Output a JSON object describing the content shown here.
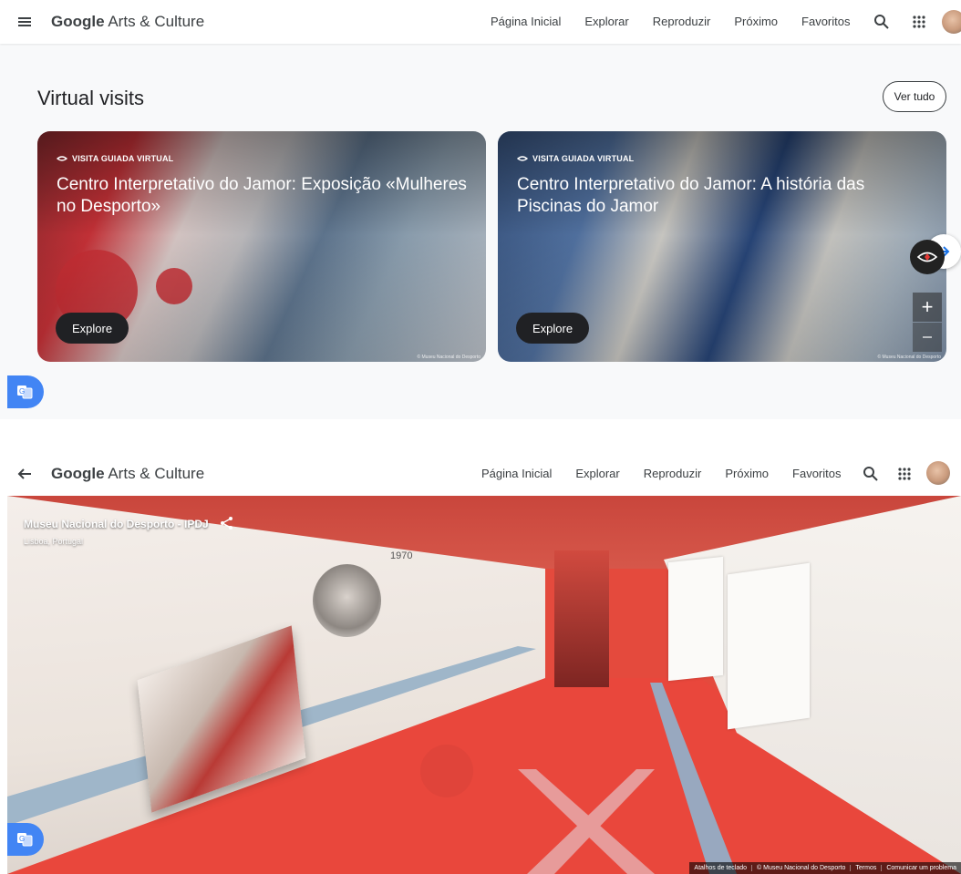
{
  "header": {
    "logo_brand": "Google",
    "logo_rest": " Arts & Culture",
    "nav": [
      "Página Inicial",
      "Explorar",
      "Reproduzir",
      "Próximo",
      "Favoritos"
    ],
    "menu_icon": "menu-icon",
    "search_icon": "search-icon",
    "apps_icon": "apps-grid-icon"
  },
  "section": {
    "title": "Virtual visits",
    "see_all": "Ver tudo"
  },
  "cards": [
    {
      "badge": "VISITA GUIADA VIRTUAL",
      "title": "Centro Interpretativo do Jamor: Exposição «Mulheres no Desporto»",
      "button": "Explore",
      "credit": "© Museu Nacional do Desporto"
    },
    {
      "badge": "VISITA GUIADA VIRTUAL",
      "title": "Centro Interpretativo do Jamor: A história das Piscinas do Jamor",
      "button": "Explore",
      "credit": "© Museu Nacional do Desporto"
    }
  ],
  "viewer": {
    "title": "Museu Nacional do Desporto - IPDJ",
    "location": "Lisboa, Portugal",
    "year_label": "1970",
    "zoom_in": "+",
    "footer": [
      "Atalhos de teclado",
      "© Museu Nacional do Desporto",
      "Termos",
      "Comunicar um problema"
    ]
  },
  "colors": {
    "accent_blue": "#4285f4",
    "dark_button": "#202124",
    "background_gray": "#f8f9fa"
  }
}
